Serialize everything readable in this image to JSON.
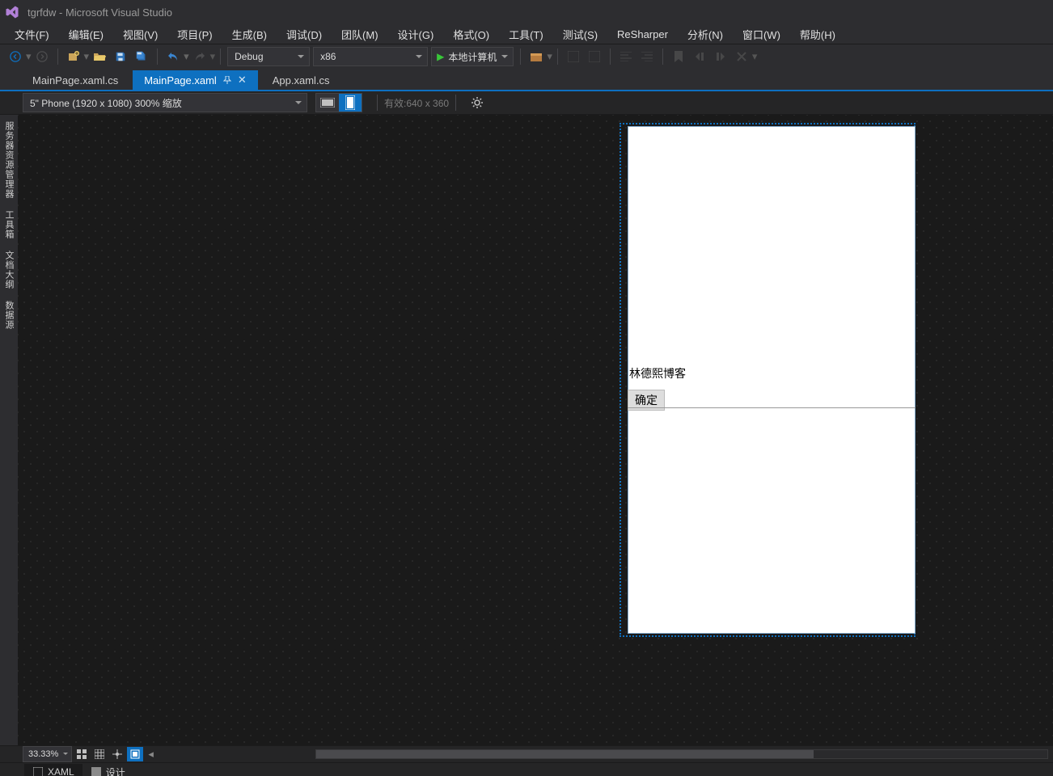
{
  "title": "tgrfdw - Microsoft Visual Studio",
  "menu": [
    "文件(F)",
    "编辑(E)",
    "视图(V)",
    "项目(P)",
    "生成(B)",
    "调试(D)",
    "团队(M)",
    "设计(G)",
    "格式(O)",
    "工具(T)",
    "测试(S)",
    "ReSharper",
    "分析(N)",
    "窗口(W)",
    "帮助(H)"
  ],
  "toolbar": {
    "config": "Debug",
    "platform": "x86",
    "run_target": "本地计算机"
  },
  "tabs": [
    {
      "label": "MainPage.xaml.cs",
      "active": false
    },
    {
      "label": "MainPage.xaml",
      "active": true
    },
    {
      "label": "App.xaml.cs",
      "active": false
    }
  ],
  "designer": {
    "device": "5\" Phone (1920 x 1080) 300% 缩放",
    "effective": "有效:640 x 360",
    "preview_text": "林德熙博客",
    "preview_button": "确定"
  },
  "side_tabs": [
    "服务器资源管理器",
    "工具箱",
    "文档大纲",
    "数据源"
  ],
  "zoom": "33.33%",
  "panes": {
    "xaml": "XAML",
    "design": "设计"
  }
}
